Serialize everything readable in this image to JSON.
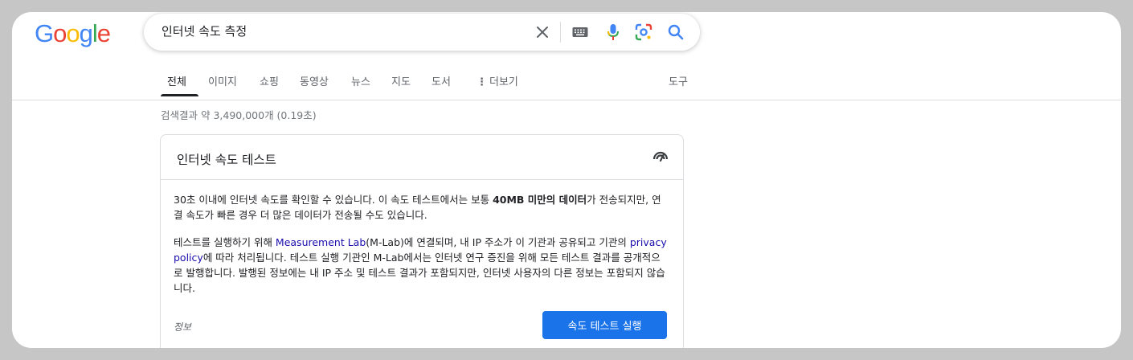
{
  "logo": {
    "letters": [
      "G",
      "o",
      "o",
      "g",
      "l",
      "e"
    ],
    "colors": [
      "#4285f4",
      "#ea4335",
      "#fbbc05",
      "#4285f4",
      "#34a853",
      "#ea4335"
    ]
  },
  "search": {
    "query": "인터넷 속도 측정"
  },
  "tabs": [
    {
      "label": "전체",
      "active": true
    },
    {
      "label": "이미지"
    },
    {
      "label": "쇼핑"
    },
    {
      "label": "동영상"
    },
    {
      "label": "뉴스"
    },
    {
      "label": "지도"
    },
    {
      "label": "도서"
    },
    {
      "label": "더보기"
    }
  ],
  "tools_label": "도구",
  "stats": "검색결과 약 3,490,000개 (0.19초)",
  "card": {
    "title": "인터넷 속도 테스트",
    "para1_a": "30초 이내에 인터넷 속도를 확인할 수 있습니다. 이 속도 테스트에서는 보통 ",
    "para1_bold": "40MB 미만의 데이터",
    "para1_b": "가 전송되지만, 연결 속도가 빠른 경우 더 많은 데이터가 전송될 수도 있습니다.",
    "para2_a": "테스트를 실행하기 위해 ",
    "para2_link1": "Measurement Lab",
    "para2_b": "(M-Lab)에 연결되며, 내 IP 주소가 이 기관과 공유되고 기관의 ",
    "para2_link2": "privacy policy",
    "para2_c": "에 따라 처리됩니다. 테스트 실행 기관인 M-Lab에서는 인터넷 연구 증진을 위해 모든 테스트 결과를 공개적으로 발행합니다. 발행된 정보에는 내 IP 주소 및 테스트 결과가 포함되지만, 인터넷 사용자의 다른 정보는 포함되지 않습니다.",
    "info_label": "정보",
    "run_button": "속도 테스트 실행"
  }
}
